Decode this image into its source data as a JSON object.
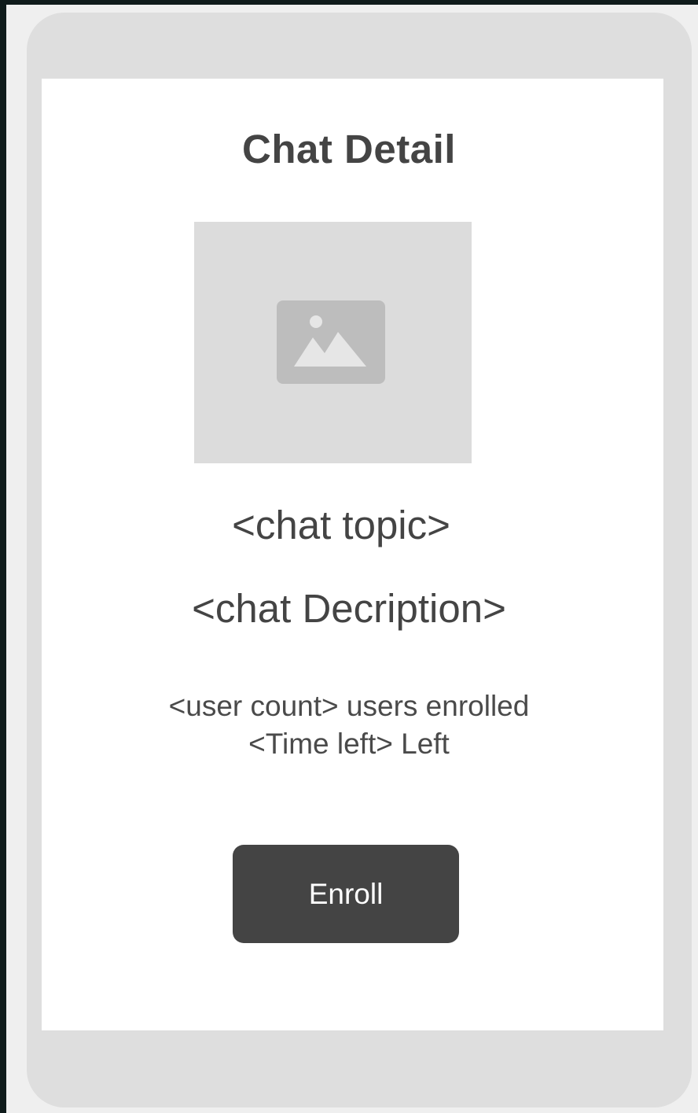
{
  "screen": {
    "title": "Chat Detail",
    "image": {
      "icon": "image-placeholder-icon"
    },
    "topic": "<chat topic>",
    "description": "<chat Decription>",
    "users_enrolled": "<user count> users enrolled",
    "time_left": "<Time left> Left",
    "enroll_label": "Enroll"
  },
  "colors": {
    "outer_background": "#0f1b1b",
    "canvas": "#efefef",
    "device_frame": "#dedede",
    "screen_background": "#ffffff",
    "text": "#444444",
    "placeholder_fill": "#dcdcdc",
    "placeholder_icon": "#bdbdbd",
    "button": "#444444",
    "button_text": "#ffffff"
  }
}
